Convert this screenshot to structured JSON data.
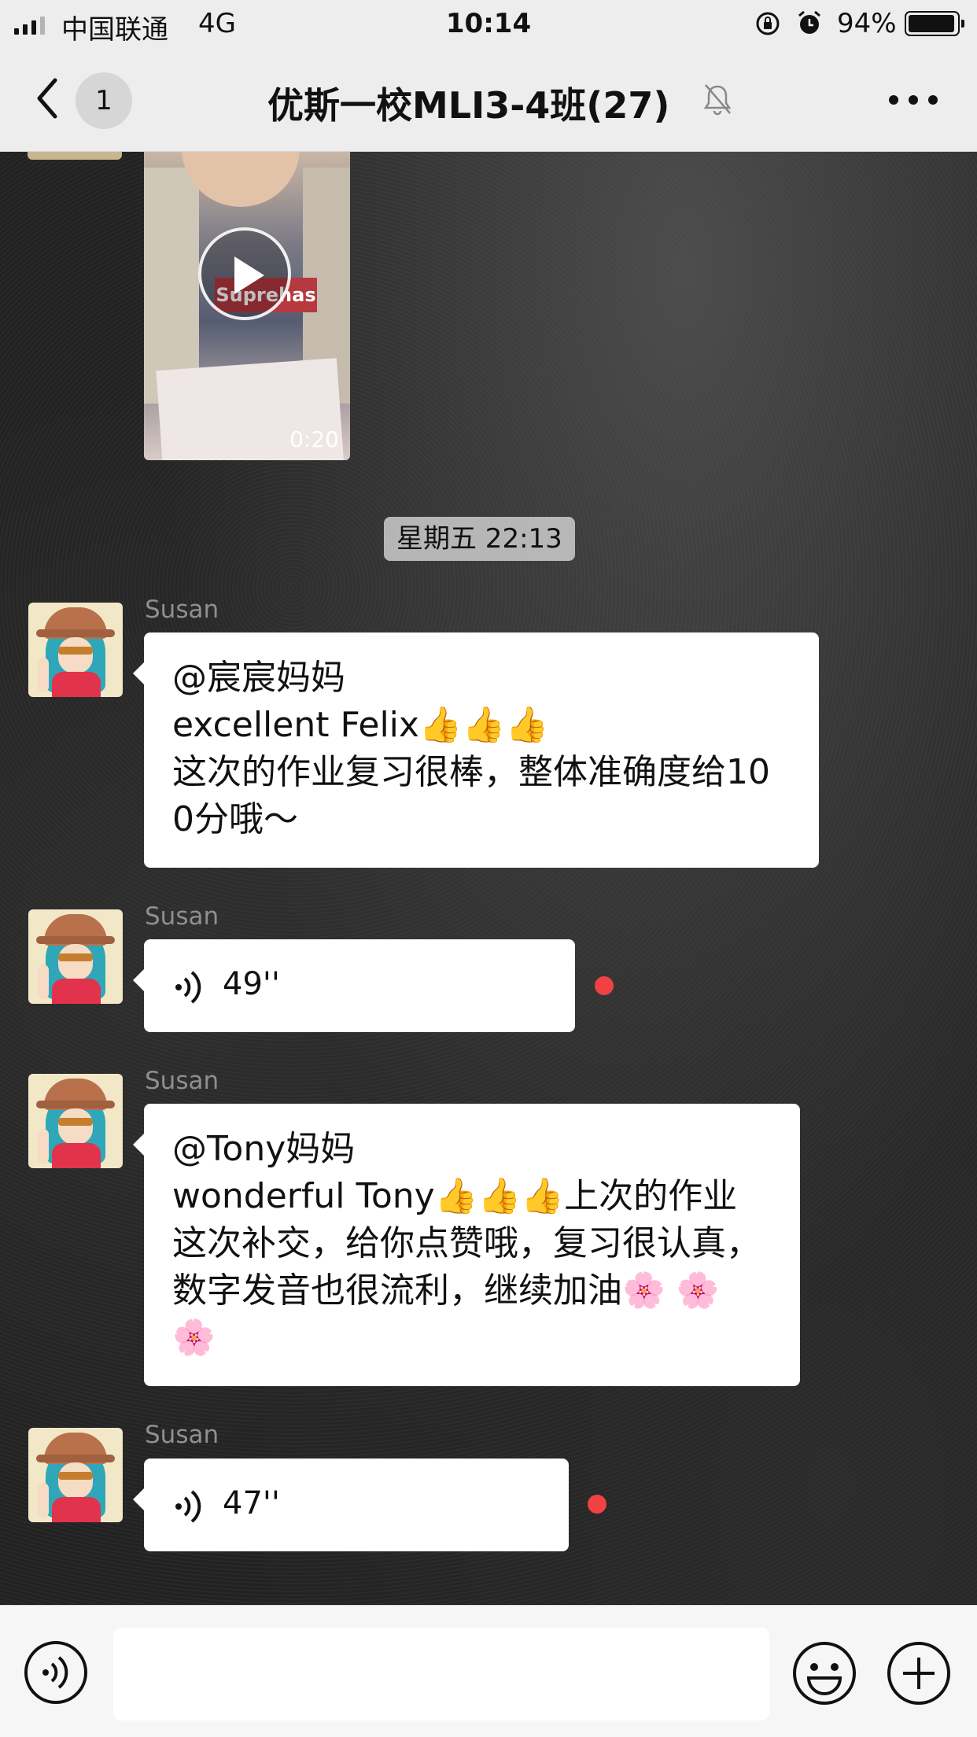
{
  "status_bar": {
    "carrier": "中国联通",
    "network": "4G",
    "time": "10:14",
    "battery_percent": "94%"
  },
  "nav": {
    "unread_count": "1",
    "title": "优斯一校MLI3-4班(27)",
    "icons": [
      "back-chevron-icon",
      "mute-bell-icon",
      "more-dots-icon"
    ]
  },
  "chat": {
    "video": {
      "duration": "0:20",
      "shirt_text": "Suprehas"
    },
    "timestamp": "星期五 22:13",
    "messages": [
      {
        "type": "text",
        "sender": "Susan",
        "text": "@宸宸妈妈\nexcellent Felix👍👍👍\n这次的作业复习很棒，整体准确度给100分哦～"
      },
      {
        "type": "voice",
        "sender": "Susan",
        "duration": "49''",
        "unread": true
      },
      {
        "type": "text",
        "sender": "Susan",
        "text": "@Tony妈妈\nwonderful Tony👍👍👍上次的作业这次补交，给你点赞哦，复习很认真，数字发音也很流利，继续加油🌸 🌸 🌸"
      },
      {
        "type": "voice",
        "sender": "Susan",
        "duration": "47''",
        "unread": true
      }
    ]
  },
  "input_bar": {
    "input_value": "",
    "icons": [
      "voice-input-icon",
      "emoji-icon",
      "plus-icon"
    ]
  },
  "colors": {
    "bar_bg": "#ededed",
    "bubble_bg": "#ffffff",
    "unread_dot": "#f04242"
  }
}
